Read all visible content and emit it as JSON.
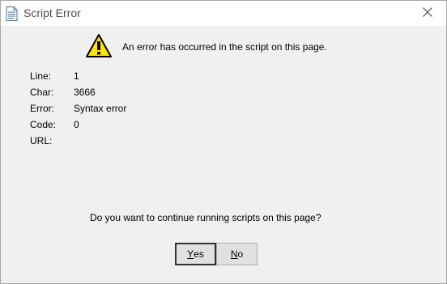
{
  "window": {
    "title": "Script Error",
    "icon": "document-icon",
    "close_icon": "close-icon"
  },
  "dialog": {
    "warning_icon": "warning-icon",
    "message": "An error has occurred in the script on this page.",
    "details": [
      {
        "label": "Line:",
        "value": "1"
      },
      {
        "label": "Char:",
        "value": "3666"
      },
      {
        "label": "Error:",
        "value": "Syntax error"
      },
      {
        "label": "Code:",
        "value": "0"
      },
      {
        "label": "URL:",
        "value": ""
      }
    ],
    "question": "Do you want to continue running scripts on this page?",
    "buttons": {
      "yes": {
        "mnemonic": "Y",
        "rest": "es"
      },
      "no": {
        "mnemonic": "N",
        "rest": "o"
      }
    }
  },
  "colors": {
    "warning_yellow": "#ffe600",
    "button_face": "#e1e1e1"
  }
}
